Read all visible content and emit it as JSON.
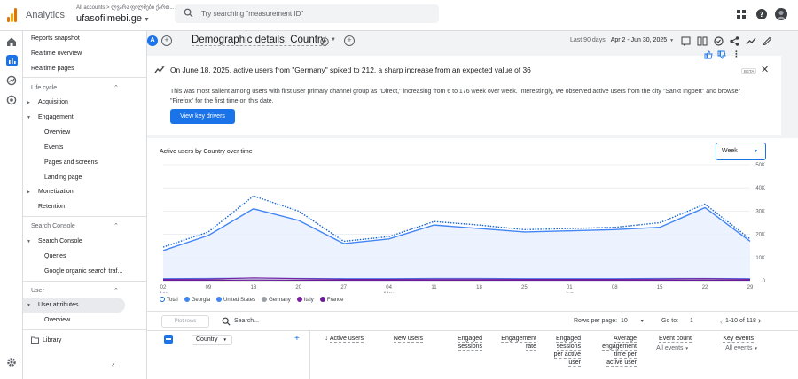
{
  "topbar": {
    "app_name": "Analytics",
    "account_path": "All accounts > ლვარა ფილმები ქართ...",
    "property": "ufasofilmebi.ge",
    "search_placeholder": "Try searching \"measurement ID\""
  },
  "nav": {
    "reports_snapshot": "Reports snapshot",
    "realtime_overview": "Realtime overview",
    "realtime_pages": "Realtime pages",
    "life_cycle": "Life cycle",
    "acquisition": "Acquisition",
    "engagement": "Engagement",
    "overview": "Overview",
    "events": "Events",
    "pages_and_screens": "Pages and screens",
    "landing_page": "Landing page",
    "monetization": "Monetization",
    "retention": "Retention",
    "search_console_hdr": "Search Console",
    "search_console": "Search Console",
    "queries": "Queries",
    "google_organic": "Google organic search traf...",
    "user_hdr": "User",
    "user_attributes": "User attributes",
    "user_overview": "Overview",
    "library": "Library"
  },
  "header": {
    "avatar_letter": "A",
    "title": "Demographic details: Country",
    "date_label": "Last 90 days",
    "date_range": "Apr 2 - Jun 30, 2025"
  },
  "insight": {
    "title": "On June 18, 2025, active users from \"Germany\" spiked to 212, a sharp increase from an expected value of 36",
    "body": "This was most salient among users with first user primary channel group as \"Direct,\" increasing from 6 to 176 week over week. Interestingly, we observed active users from the city \"Sankt Ingbert\" and browser \"Firefox\" for the first time on this date.",
    "button": "View key drivers",
    "beta": "BETA"
  },
  "chart": {
    "title": "Active users by Country over time",
    "interval": "Week"
  },
  "chart_data": {
    "type": "line",
    "x": [
      "02 Apr",
      "06",
      "13",
      "20",
      "27",
      "04 May",
      "11",
      "18",
      "25",
      "01 Jun",
      "08",
      "15",
      "22",
      "29"
    ],
    "x_tick_labels": [
      "02",
      "09",
      "13",
      "20",
      "27",
      "04",
      "11",
      "18",
      "25",
      "01",
      "08",
      "15",
      "22",
      "29"
    ],
    "x_month_labels": [
      "Apr",
      "May",
      "Jun"
    ],
    "y_ticks": [
      "0",
      "10K",
      "20K",
      "30K",
      "40K",
      "50K"
    ],
    "ylim": [
      0,
      50000
    ],
    "series": [
      {
        "name": "Total",
        "color": "#1967d2",
        "style": "dotted",
        "values": [
          14500,
          21000,
          36500,
          30000,
          17000,
          19000,
          25500,
          24000,
          22000,
          22500,
          23000,
          25000,
          33000,
          18000
        ]
      },
      {
        "name": "Georgia",
        "color": "#4285f4",
        "style": "solid",
        "values": [
          13000,
          19500,
          31000,
          26000,
          16000,
          18000,
          24000,
          22500,
          21000,
          21500,
          22000,
          23000,
          31500,
          17000
        ]
      },
      {
        "name": "United States",
        "color": "#4285f4",
        "style": "solid",
        "values": [
          900,
          1000,
          1100,
          1000,
          900,
          900,
          1000,
          1000,
          900,
          900,
          900,
          1000,
          1000,
          900
        ]
      },
      {
        "name": "Germany",
        "color": "#9aa0a6",
        "style": "solid",
        "values": [
          300,
          300,
          400,
          300,
          300,
          300,
          300,
          300,
          300,
          300,
          300,
          300,
          350,
          300
        ]
      },
      {
        "name": "Italy",
        "color": "#7b1fa2",
        "style": "solid",
        "values": [
          600,
          700,
          1200,
          900,
          600,
          600,
          700,
          700,
          600,
          600,
          600,
          700,
          900,
          600
        ]
      },
      {
        "name": "France",
        "color": "#6a1b9a",
        "style": "solid",
        "values": [
          200,
          200,
          250,
          200,
          200,
          200,
          200,
          200,
          200,
          200,
          200,
          200,
          220,
          200
        ]
      }
    ]
  },
  "table": {
    "plot_rows": "Plot rows",
    "search_placeholder": "Search...",
    "rows_per_page_label": "Rows per page:",
    "rows_per_page": "10",
    "goto_label": "Go to:",
    "goto_value": "1",
    "page_info": "1-10 of 118",
    "dimension": "Country",
    "columns": {
      "active_users": "Active users",
      "new_users": "New users",
      "engaged_sessions": "Engaged\nsessions",
      "engagement_rate": "Engagement\nrate",
      "engaged_sessions_per_user": "Engaged\nsessions\nper active\nuser",
      "avg_engagement_time": "Average\nengagement\ntime per\nactive user",
      "event_count": "Event count",
      "key_events": "Key events",
      "all_events": "All events"
    }
  }
}
